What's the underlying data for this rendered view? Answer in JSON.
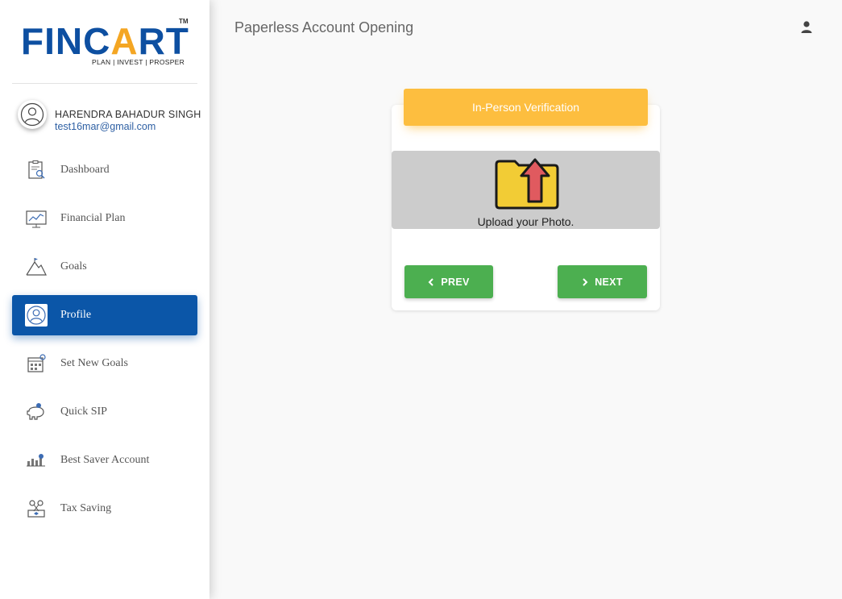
{
  "brand": {
    "logo_text_1": "FINC",
    "logo_text_accent": "A",
    "logo_text_2": "RT",
    "trademark": "TM",
    "tagline": "PLAN | INVEST | PROSPER"
  },
  "user": {
    "name": "HARENDRA BAHADUR SINGH",
    "email": "test16mar@gmail.com"
  },
  "sidebar": {
    "items": [
      {
        "label": "Dashboard",
        "icon": "dashboard-icon"
      },
      {
        "label": "Financial Plan",
        "icon": "chart-icon"
      },
      {
        "label": "Goals",
        "icon": "mountain-icon"
      },
      {
        "label": "Profile",
        "icon": "profile-icon",
        "active": true
      },
      {
        "label": "Set New Goals",
        "icon": "calendar-icon"
      },
      {
        "label": "Quick SIP",
        "icon": "piggy-bank-icon"
      },
      {
        "label": "Best Saver Account",
        "icon": "savings-icon"
      },
      {
        "label": "Tax Saving",
        "icon": "tax-icon"
      }
    ]
  },
  "header": {
    "title": "Paperless Account Opening",
    "user_icon": "person-icon"
  },
  "card": {
    "title": "In-Person Verification",
    "upload_label": "Upload your Photo.",
    "upload_icon": "folder-upload-icon",
    "prev_label": "PREV",
    "next_label": "NEXT"
  },
  "colors": {
    "brand_blue": "#0d4fa1",
    "brand_orange": "#f4a623",
    "active_nav": "#0b56a8",
    "card_header": "#fdbe3f",
    "button_green": "#4caf50",
    "upload_bg": "#cccccc"
  }
}
